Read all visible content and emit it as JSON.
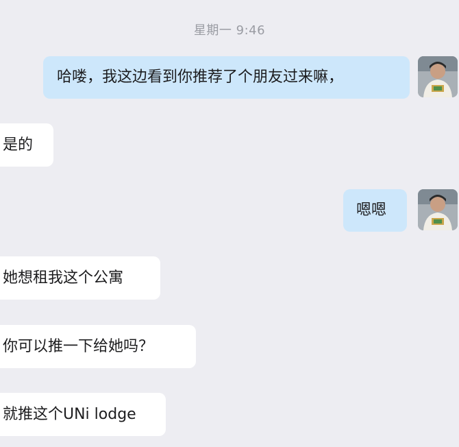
{
  "conversation": {
    "timestamp": "星期一 9:46",
    "messages": [
      {
        "direction": "out",
        "text": "哈喽，我这边看到你推荐了个朋友过来嘛，"
      },
      {
        "direction": "in",
        "text": "是的"
      },
      {
        "direction": "out",
        "text": "嗯嗯"
      },
      {
        "direction": "in",
        "text": "她想租我这个公寓"
      },
      {
        "direction": "in",
        "text": "你可以推一下给她吗？"
      },
      {
        "direction": "in",
        "text": "就推这个UNi lodge"
      }
    ]
  },
  "avatar": {
    "icon": "user-photo-avatar"
  },
  "colors": {
    "background": "#ededf2",
    "outgoing_bubble": "#cde7fb",
    "incoming_bubble": "#ffffff",
    "timestamp_text": "#9a9ca3"
  }
}
